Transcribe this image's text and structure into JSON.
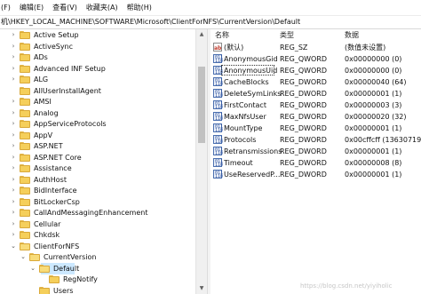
{
  "menu": [
    "(F)",
    "编辑(E)",
    "查看(V)",
    "收藏夹(A)",
    "帮助(H)"
  ],
  "address": "机\\HKEY_LOCAL_MACHINE\\SOFTWARE\\Microsoft\\ClientForNFS\\CurrentVersion\\Default",
  "tree": {
    "items": [
      {
        "label": "Active Setup",
        "chevron": "›"
      },
      {
        "label": "ActiveSync",
        "chevron": "›"
      },
      {
        "label": "ADs",
        "chevron": "›"
      },
      {
        "label": "Advanced INF Setup",
        "chevron": "›"
      },
      {
        "label": "ALG",
        "chevron": "›"
      },
      {
        "label": "AllUserInstallAgent",
        "chevron": ""
      },
      {
        "label": "AMSI",
        "chevron": "›"
      },
      {
        "label": "Analog",
        "chevron": "›"
      },
      {
        "label": "AppServiceProtocols",
        "chevron": "›"
      },
      {
        "label": "AppV",
        "chevron": "›"
      },
      {
        "label": "ASP.NET",
        "chevron": "›"
      },
      {
        "label": "ASP.NET Core",
        "chevron": "›"
      },
      {
        "label": "Assistance",
        "chevron": "›"
      },
      {
        "label": "AuthHost",
        "chevron": "›"
      },
      {
        "label": "BidInterface",
        "chevron": "›"
      },
      {
        "label": "BitLockerCsp",
        "chevron": "›"
      },
      {
        "label": "CallAndMessagingEnhancement",
        "chevron": "›"
      },
      {
        "label": "Cellular",
        "chevron": "›"
      },
      {
        "label": "Chkdsk",
        "chevron": "›"
      },
      {
        "label": "ClientForNFS",
        "chevron": "⌄"
      },
      {
        "label": "CurrentVersion",
        "chevron": "⌄"
      },
      {
        "label": "Default",
        "chevron": "⌄"
      },
      {
        "label": "RegNotify",
        "chevron": ""
      },
      {
        "label": "Users",
        "chevron": ""
      }
    ]
  },
  "columns": {
    "name": "名称",
    "type": "类型",
    "data": "数据"
  },
  "values": [
    {
      "name": "(默认)",
      "type": "REG_SZ",
      "data": "(数值未设置)",
      "icon": "string-value-icon"
    },
    {
      "name": "AnonymousGid",
      "type": "REG_QWORD",
      "data": "0x00000000 (0)",
      "icon": "binary-value-icon"
    },
    {
      "name": "AnonymousUid",
      "type": "REG_QWORD",
      "data": "0x00000000 (0)",
      "icon": "binary-value-icon"
    },
    {
      "name": "CacheBlocks",
      "type": "REG_DWORD",
      "data": "0x00000040 (64)",
      "icon": "binary-value-icon"
    },
    {
      "name": "DeleteSymLinks",
      "type": "REG_DWORD",
      "data": "0x00000001 (1)",
      "icon": "binary-value-icon"
    },
    {
      "name": "FirstContact",
      "type": "REG_DWORD",
      "data": "0x00000003 (3)",
      "icon": "binary-value-icon"
    },
    {
      "name": "MaxNfsUser",
      "type": "REG_DWORD",
      "data": "0x00000020 (32)",
      "icon": "binary-value-icon"
    },
    {
      "name": "MountType",
      "type": "REG_DWORD",
      "data": "0x00000001 (1)",
      "icon": "binary-value-icon"
    },
    {
      "name": "Protocols",
      "type": "REG_DWORD",
      "data": "0x00cffcff (13630719)",
      "icon": "binary-value-icon"
    },
    {
      "name": "Retransmissions",
      "type": "REG_DWORD",
      "data": "0x00000001 (1)",
      "icon": "binary-value-icon"
    },
    {
      "name": "Timeout",
      "type": "REG_DWORD",
      "data": "0x00000008 (8)",
      "icon": "binary-value-icon"
    },
    {
      "name": "UseReservedP...",
      "type": "REG_DWORD",
      "data": "0x00000001 (1)",
      "icon": "binary-value-icon"
    }
  ],
  "watermark": "https://blog.csdn.net/yiyiholic",
  "colors": {
    "selection": "#cce8ff",
    "folder": "#f5cf5b"
  }
}
